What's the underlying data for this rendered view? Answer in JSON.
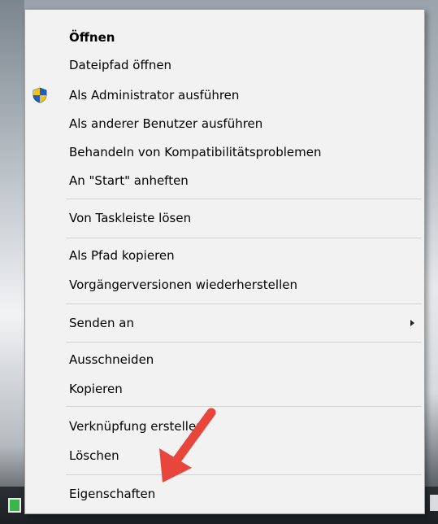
{
  "menu": {
    "items": [
      {
        "label": "Öffnen",
        "bold": true
      },
      {
        "label": "Dateipfad öffnen"
      },
      {
        "label": "Als Administrator ausführen",
        "icon": "uac-shield-icon"
      },
      {
        "label": "Als anderer Benutzer ausführen"
      },
      {
        "label": "Behandeln von Kompatibilitätsproblemen"
      },
      {
        "label": "An \"Start\" anheften"
      },
      {
        "label": "Von Taskleiste lösen"
      },
      {
        "label": "Als Pfad kopieren"
      },
      {
        "label": "Vorgängerversionen wiederherstellen"
      },
      {
        "label": "Senden an",
        "submenu": true
      },
      {
        "label": "Ausschneiden"
      },
      {
        "label": "Kopieren"
      },
      {
        "label": "Verknüpfung erstellen"
      },
      {
        "label": "Löschen"
      },
      {
        "label": "Eigenschaften"
      }
    ]
  },
  "colors": {
    "menu_bg": "#f2f2f2",
    "separator": "#d3d3d3",
    "annotation_arrow": "#e8453c"
  }
}
